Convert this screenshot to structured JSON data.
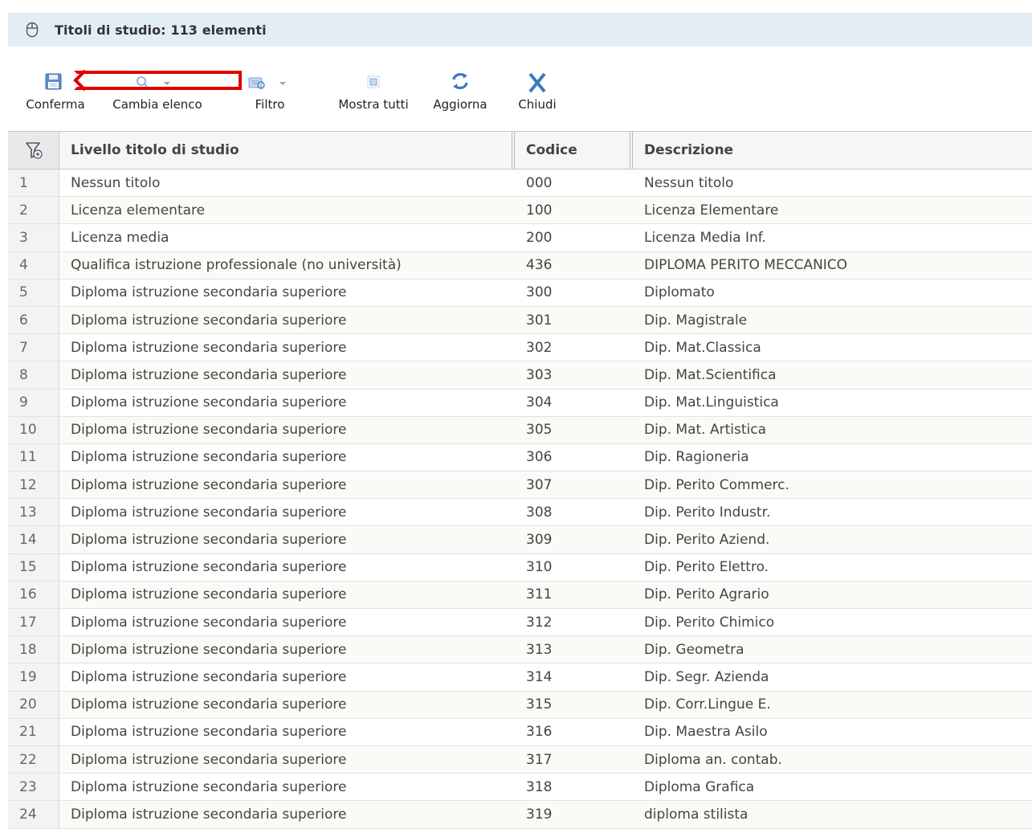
{
  "window": {
    "title": "Titoli di studio: 113 elementi"
  },
  "toolbar": {
    "conferma": "Conferma",
    "cambia_elenco": "Cambia elenco",
    "filtro": "Filtro",
    "mostra_tutti": "Mostra tutti",
    "aggiorna": "Aggiorna",
    "chiudi": "Chiudi"
  },
  "colors": {
    "title_bar": "#e3edf6",
    "accent_blue": "#4a86c5",
    "highlight_red": "#e00000"
  },
  "grid": {
    "columns": [
      "Livello titolo di studio",
      "Codice",
      "Descrizione"
    ],
    "rows": [
      {
        "n": "1",
        "livello": "Nessun titolo",
        "codice": "000",
        "descrizione": "Nessun titolo"
      },
      {
        "n": "2",
        "livello": "Licenza elementare",
        "codice": "100",
        "descrizione": "Licenza Elementare"
      },
      {
        "n": "3",
        "livello": "Licenza media",
        "codice": "200",
        "descrizione": "Licenza Media Inf."
      },
      {
        "n": "4",
        "livello": "Qualifica istruzione professionale (no università)",
        "codice": "436",
        "descrizione": "DIPLOMA PERITO MECCANICO"
      },
      {
        "n": "5",
        "livello": "Diploma istruzione secondaria superiore",
        "codice": "300",
        "descrizione": "Diplomato"
      },
      {
        "n": "6",
        "livello": "Diploma istruzione secondaria superiore",
        "codice": "301",
        "descrizione": "Dip. Magistrale"
      },
      {
        "n": "7",
        "livello": "Diploma istruzione secondaria superiore",
        "codice": "302",
        "descrizione": "Dip. Mat.Classica"
      },
      {
        "n": "8",
        "livello": "Diploma istruzione secondaria superiore",
        "codice": "303",
        "descrizione": "Dip. Mat.Scientifica"
      },
      {
        "n": "9",
        "livello": "Diploma istruzione secondaria superiore",
        "codice": "304",
        "descrizione": "Dip. Mat.Linguistica"
      },
      {
        "n": "10",
        "livello": "Diploma istruzione secondaria superiore",
        "codice": "305",
        "descrizione": "Dip. Mat. Artistica"
      },
      {
        "n": "11",
        "livello": "Diploma istruzione secondaria superiore",
        "codice": "306",
        "descrizione": "Dip. Ragioneria"
      },
      {
        "n": "12",
        "livello": "Diploma istruzione secondaria superiore",
        "codice": "307",
        "descrizione": "Dip. Perito Commerc."
      },
      {
        "n": "13",
        "livello": "Diploma istruzione secondaria superiore",
        "codice": "308",
        "descrizione": "Dip. Perito Industr."
      },
      {
        "n": "14",
        "livello": "Diploma istruzione secondaria superiore",
        "codice": "309",
        "descrizione": "Dip. Perito Aziend."
      },
      {
        "n": "15",
        "livello": "Diploma istruzione secondaria superiore",
        "codice": "310",
        "descrizione": "Dip. Perito Elettro."
      },
      {
        "n": "16",
        "livello": "Diploma istruzione secondaria superiore",
        "codice": "311",
        "descrizione": "Dip. Perito Agrario"
      },
      {
        "n": "17",
        "livello": "Diploma istruzione secondaria superiore",
        "codice": "312",
        "descrizione": "Dip. Perito Chimico"
      },
      {
        "n": "18",
        "livello": "Diploma istruzione secondaria superiore",
        "codice": "313",
        "descrizione": "Dip. Geometra"
      },
      {
        "n": "19",
        "livello": "Diploma istruzione secondaria superiore",
        "codice": "314",
        "descrizione": "Dip. Segr. Azienda"
      },
      {
        "n": "20",
        "livello": "Diploma istruzione secondaria superiore",
        "codice": "315",
        "descrizione": "Dip. Corr.Lingue E."
      },
      {
        "n": "21",
        "livello": "Diploma istruzione secondaria superiore",
        "codice": "316",
        "descrizione": "Dip. Maestra Asilo"
      },
      {
        "n": "22",
        "livello": "Diploma istruzione secondaria superiore",
        "codice": "317",
        "descrizione": "Diploma an. contab."
      },
      {
        "n": "23",
        "livello": "Diploma istruzione secondaria superiore",
        "codice": "318",
        "descrizione": "Diploma Grafica"
      },
      {
        "n": "24",
        "livello": "Diploma istruzione secondaria superiore",
        "codice": "319",
        "descrizione": "diploma stilista"
      }
    ]
  }
}
